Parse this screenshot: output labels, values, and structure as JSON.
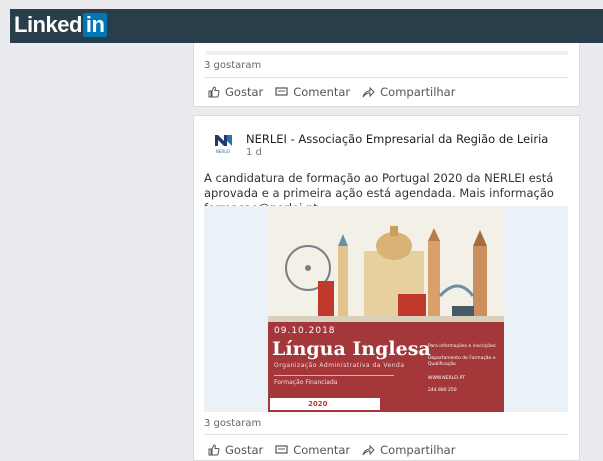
{
  "header": {
    "logo_text": "Linked",
    "logo_in": "in"
  },
  "post1": {
    "likes": "3 gostaram",
    "actions": {
      "like": "Gostar",
      "comment": "Comentar",
      "share": "Compartilhar"
    }
  },
  "post2": {
    "org_name": "NERLEI - Associação Empresarial da Região de Leiria",
    "org_logo_text": "NERLEI",
    "time": "1 d",
    "text": "A candidatura de formação ao Portugal 2020 da NERLEI está aprovada e a primeira ação está agendada. Mais informação formacao@nerlei.pt",
    "poster": {
      "date": "09.10.2018",
      "title": "Língua Inglesa",
      "subtitle": "Organização Administrativa da Venda",
      "financed": "Formação Financiada",
      "info": "Para informações e inscrições:",
      "dept": "Departamento de Formação e Qualificação",
      "site": "WWW.NERLEI.PT",
      "phone": "244 880 250",
      "footer_logo": "2020"
    },
    "likes": "3 gostaram",
    "actions": {
      "like": "Gostar",
      "comment": "Comentar",
      "share": "Compartilhar"
    }
  },
  "colors": {
    "topbar": "#283e4a",
    "linkedin_blue": "#0077b5",
    "poster_red": "#a3373a"
  }
}
